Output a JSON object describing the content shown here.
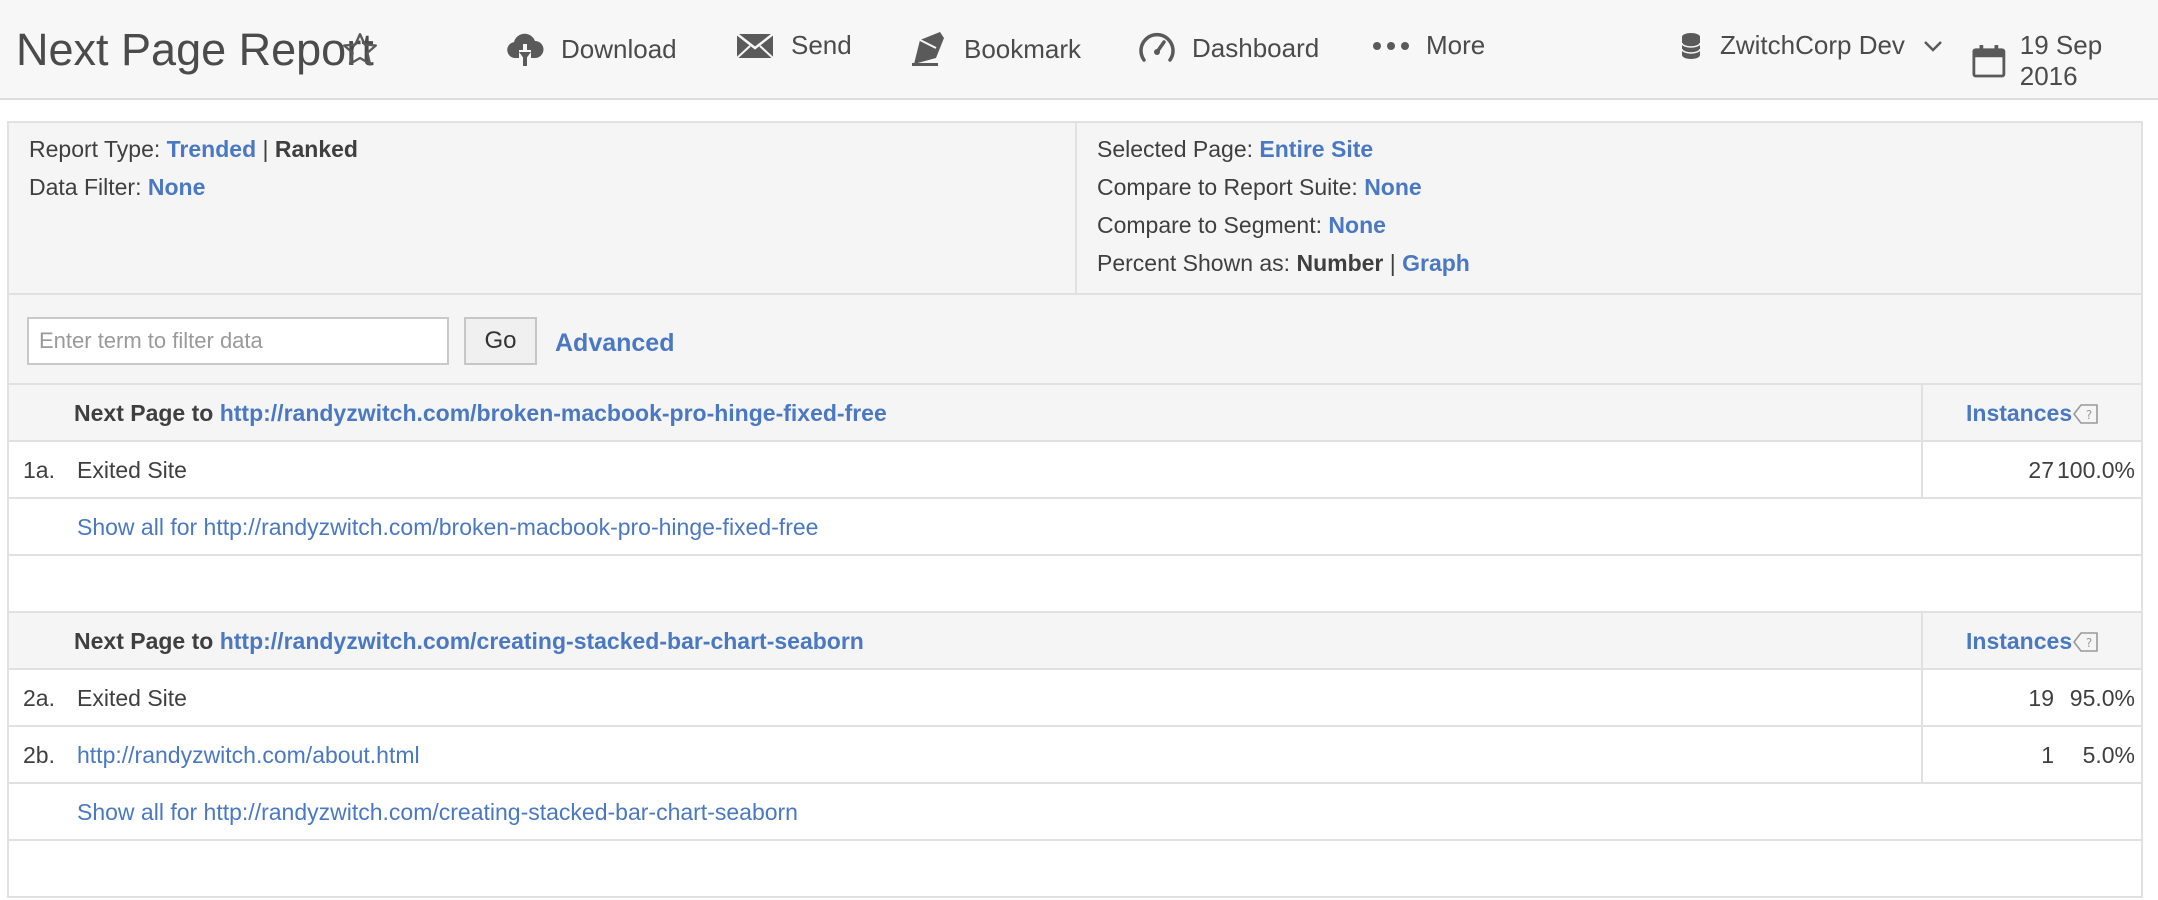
{
  "header": {
    "title": "Next Page Report",
    "toolbar": {
      "download": "Download",
      "send": "Send",
      "bookmark": "Bookmark",
      "dashboard": "Dashboard",
      "more": "More"
    },
    "report_suite": "ZwitchCorp Dev",
    "date": "19 Sep 2016"
  },
  "info": {
    "report_type_label": "Report Type:",
    "report_type_trended": "Trended",
    "report_type_sep": "|",
    "report_type_ranked": "Ranked",
    "data_filter_label": "Data Filter:",
    "data_filter_value": "None",
    "selected_page_label": "Selected Page:",
    "selected_page_value": "Entire Site",
    "compare_suite_label": "Compare to Report Suite:",
    "compare_suite_value": "None",
    "compare_segment_label": "Compare to Segment:",
    "compare_segment_value": "None",
    "percent_label": "Percent Shown as:",
    "percent_number": "Number",
    "percent_sep": "|",
    "percent_graph": "Graph"
  },
  "filter": {
    "placeholder": "Enter term to filter data",
    "go": "Go",
    "advanced": "Advanced"
  },
  "sections": [
    {
      "header_prefix": "Next Page to",
      "header_url": "http://randyzwitch.com/broken-macbook-pro-hinge-fixed-free",
      "metric": "Instances",
      "rows": [
        {
          "idx": "1a.",
          "label": "Exited Site",
          "count": "27",
          "pct": "100.0%"
        }
      ],
      "show_all": "Show all for http://randyzwitch.com/broken-macbook-pro-hinge-fixed-free"
    },
    {
      "header_prefix": "Next Page to",
      "header_url": "http://randyzwitch.com/creating-stacked-bar-chart-seaborn",
      "metric": "Instances",
      "rows": [
        {
          "idx": "2a.",
          "label": "Exited Site",
          "count": "19",
          "pct": "95.0%"
        },
        {
          "idx": "2b.",
          "label": "http://randyzwitch.com/about.html",
          "count": "1",
          "pct": "5.0%"
        }
      ],
      "show_all": "Show all for http://randyzwitch.com/creating-stacked-bar-chart-seaborn"
    }
  ],
  "colors": {
    "accent": "#4a78c3",
    "text": "#4b4b4b",
    "panel_bg": "#f5f5f5",
    "border": "#e1e1e1"
  }
}
